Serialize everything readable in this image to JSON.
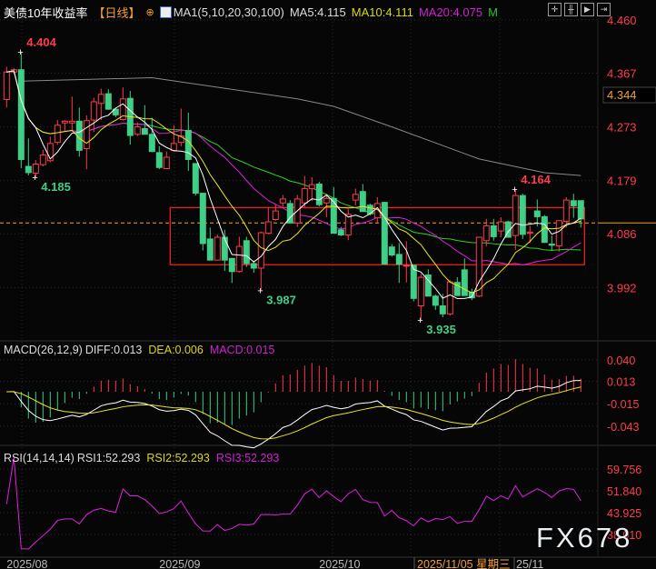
{
  "header": {
    "title": "美债10年收益率",
    "period": "【日线】",
    "ma_label": "MA1(5,10,20,30,100)",
    "ma5": "MA5:4.115",
    "ma10": "MA10:4.111",
    "ma20": "MA20:4.075",
    "more": "M"
  },
  "toolbar": [
    "crosshair-icon",
    "ruler-icon",
    "play-icon",
    "exit-icon"
  ],
  "macd_header": {
    "name": "MACD(26,12,9)",
    "diff": "DIFF:0.013",
    "dea": "DEA:0.006",
    "macd": "MACD:0.015"
  },
  "rsi_header": {
    "name": "RSI(14,14,14)",
    "rsi1": "RSI1:52.293",
    "rsi2": "RSI2:52.293",
    "rsi3": "RSI3:52.293"
  },
  "watermark": "FX678",
  "colors": {
    "up": "#ff3b4e",
    "down": "#3fcf87",
    "ma5": "#ffffff",
    "ma10": "#e8e818",
    "ma20": "#e020e0",
    "ma30": "#30d020",
    "ma100": "#888888",
    "axis": "#ff3b4e",
    "current": "#f0a030"
  },
  "chart_data": {
    "type": "candlestick",
    "price_axis": {
      "ticks": [
        "4.460",
        "4.367",
        "4.273",
        "4.179",
        "4.086",
        "3.992"
      ],
      "range": [
        3.92,
        4.46
      ]
    },
    "current_price_label": "4.344",
    "reference_price": 4.105,
    "box": {
      "top": 4.132,
      "bottom": 4.032,
      "from_index": 23,
      "to_index": 80
    },
    "annotations": [
      {
        "text": "4.404",
        "index": 2,
        "price": 4.404,
        "type": "high"
      },
      {
        "text": "4.185",
        "index": 4,
        "price": 4.185,
        "type": "low"
      },
      {
        "text": "3.987",
        "index": 35,
        "price": 3.987,
        "type": "low"
      },
      {
        "text": "3.935",
        "index": 57,
        "price": 3.935,
        "type": "low"
      },
      {
        "text": "4.164",
        "index": 70,
        "price": 4.164,
        "type": "high"
      }
    ],
    "ohlc": [
      [
        4.321,
        4.378,
        4.307,
        4.369
      ],
      [
        4.369,
        4.376,
        4.366,
        4.373
      ],
      [
        4.373,
        4.404,
        4.201,
        4.216
      ],
      [
        4.204,
        4.253,
        4.188,
        4.193
      ],
      [
        4.192,
        4.215,
        4.185,
        4.208
      ],
      [
        4.207,
        4.233,
        4.204,
        4.224
      ],
      [
        4.214,
        4.256,
        4.211,
        4.244
      ],
      [
        4.246,
        4.285,
        4.242,
        4.276
      ],
      [
        4.28,
        4.285,
        4.265,
        4.283
      ],
      [
        4.28,
        4.326,
        4.265,
        4.283
      ],
      [
        4.283,
        4.307,
        4.221,
        4.232
      ],
      [
        4.235,
        4.293,
        4.199,
        4.284
      ],
      [
        4.285,
        4.324,
        4.264,
        4.317
      ],
      [
        4.314,
        4.34,
        4.285,
        4.33
      ],
      [
        4.331,
        4.339,
        4.303,
        4.304
      ],
      [
        4.304,
        4.306,
        4.29,
        4.294
      ],
      [
        4.286,
        4.342,
        4.284,
        4.322
      ],
      [
        4.323,
        4.336,
        4.242,
        4.258
      ],
      [
        4.26,
        4.281,
        4.257,
        4.273
      ],
      [
        4.27,
        4.311,
        4.26,
        4.26
      ],
      [
        4.26,
        4.289,
        4.229,
        4.23
      ],
      [
        4.228,
        4.239,
        4.199,
        4.202
      ],
      [
        4.2,
        4.23,
        4.199,
        4.22
      ],
      [
        4.232,
        4.276,
        4.23,
        4.244
      ],
      [
        4.246,
        4.305,
        4.239,
        4.257
      ],
      [
        4.267,
        4.298,
        4.196,
        4.216
      ],
      [
        4.209,
        4.209,
        4.153,
        4.157
      ],
      [
        4.157,
        4.157,
        4.057,
        4.069
      ],
      [
        4.077,
        4.097,
        4.04,
        4.04
      ],
      [
        4.04,
        4.085,
        4.04,
        4.08
      ],
      [
        4.08,
        4.093,
        4.021,
        4.04
      ],
      [
        4.043,
        4.044,
        4.0,
        4.02
      ],
      [
        4.02,
        4.081,
        4.018,
        4.064
      ],
      [
        4.074,
        4.081,
        4.028,
        4.034
      ],
      [
        4.034,
        4.039,
        4.018,
        4.026
      ],
      [
        4.026,
        4.09,
        3.987,
        4.088
      ],
      [
        4.087,
        4.132,
        4.085,
        4.107
      ],
      [
        4.111,
        4.137,
        4.109,
        4.126
      ],
      [
        4.14,
        4.154,
        4.133,
        4.147
      ],
      [
        4.139,
        4.145,
        4.105,
        4.105
      ],
      [
        4.105,
        4.154,
        4.098,
        4.147
      ],
      [
        4.14,
        4.187,
        4.133,
        4.165
      ],
      [
        4.165,
        4.185,
        4.143,
        4.172
      ],
      [
        4.173,
        4.177,
        4.134,
        4.137
      ],
      [
        4.14,
        4.156,
        4.115,
        4.148
      ],
      [
        4.148,
        4.168,
        4.087,
        4.087
      ],
      [
        4.093,
        4.098,
        4.082,
        4.084
      ],
      [
        4.084,
        4.129,
        4.075,
        4.12
      ],
      [
        4.145,
        4.165,
        4.136,
        4.155
      ],
      [
        4.16,
        4.173,
        4.125,
        4.125
      ],
      [
        4.136,
        4.139,
        4.118,
        4.121
      ],
      [
        4.114,
        4.15,
        4.106,
        4.139
      ],
      [
        4.141,
        4.142,
        4.033,
        4.033
      ],
      [
        4.063,
        4.068,
        4.046,
        4.049
      ],
      [
        4.05,
        4.07,
        4.0,
        4.033
      ],
      [
        4.03,
        4.073,
        4.001,
        4.031
      ],
      [
        4.031,
        4.031,
        3.968,
        3.973
      ],
      [
        3.96,
        4.016,
        3.935,
        4.01
      ],
      [
        4.014,
        4.024,
        3.977,
        3.977
      ],
      [
        3.977,
        3.98,
        3.953,
        3.961
      ],
      [
        3.96,
        3.981,
        3.94,
        3.946
      ],
      [
        3.946,
        4.005,
        3.943,
        4.002
      ],
      [
        4.001,
        4.01,
        3.978,
        3.978
      ],
      [
        4.023,
        4.043,
        3.978,
        3.978
      ],
      [
        3.984,
        3.99,
        3.97,
        3.974
      ],
      [
        3.977,
        4.081,
        3.975,
        4.08
      ],
      [
        4.074,
        4.112,
        4.064,
        4.1
      ],
      [
        4.1,
        4.112,
        4.074,
        4.081
      ],
      [
        4.091,
        4.115,
        4.08,
        4.107
      ],
      [
        4.107,
        4.109,
        4.079,
        4.08
      ],
      [
        4.083,
        4.164,
        4.058,
        4.153
      ],
      [
        4.153,
        4.156,
        4.077,
        4.085
      ],
      [
        4.087,
        4.1,
        4.07,
        4.089
      ],
      [
        4.126,
        4.146,
        4.099,
        4.116
      ],
      [
        4.116,
        4.119,
        4.07,
        4.071
      ],
      [
        4.068,
        4.083,
        4.056,
        4.066
      ],
      [
        4.065,
        4.11,
        4.055,
        4.109
      ],
      [
        4.108,
        4.15,
        4.097,
        4.145
      ],
      [
        4.144,
        4.156,
        4.114,
        4.135
      ],
      [
        4.144,
        4.144,
        4.097,
        4.112
      ]
    ],
    "ma100_points": [
      [
        2,
        4.353
      ],
      [
        20,
        4.359
      ],
      [
        40,
        4.322
      ],
      [
        45,
        4.309
      ],
      [
        53,
        4.273
      ],
      [
        65,
        4.217
      ],
      [
        74,
        4.193
      ],
      [
        79,
        4.188
      ]
    ],
    "macd_axis": {
      "ticks": [
        "0.040",
        "0.013",
        "-0.015",
        "-0.043"
      ],
      "range": [
        -0.06,
        0.05
      ]
    },
    "rsi_axis": {
      "ticks": [
        "59.756",
        "51.840",
        "43.925",
        "38.010"
      ],
      "range": [
        30,
        64
      ]
    },
    "x_axis": {
      "labels": [
        {
          "text": "2025/08",
          "index": 2
        },
        {
          "text": "2025/09",
          "index": 23
        },
        {
          "text": "2025/10",
          "index": 45
        }
      ],
      "cursor_label": "2025/11/05 星期三",
      "end_label": "25/11"
    }
  }
}
